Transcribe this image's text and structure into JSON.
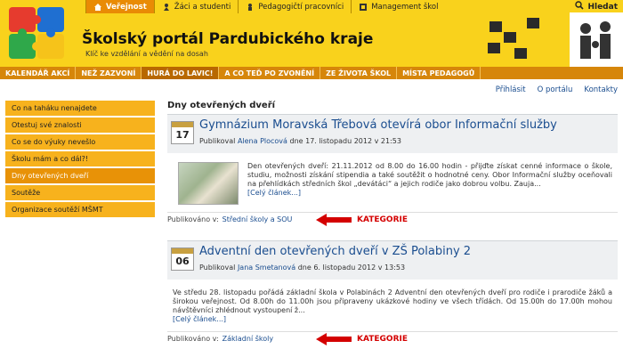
{
  "header": {
    "title": "Školský portál Pardubického kraje",
    "subtitle": "Klíč ke vzdělání a vědění na dosah",
    "search_label": "Hledat"
  },
  "top_tabs": [
    {
      "label": "Veřejnost",
      "icon": "home-icon"
    },
    {
      "label": "Žáci a studenti",
      "icon": "students-icon"
    },
    {
      "label": "Pedagogičtí pracovníci",
      "icon": "teacher-icon"
    },
    {
      "label": "Management škol",
      "icon": "management-icon"
    }
  ],
  "main_nav": [
    "KALENDÁŘ AKCÍ",
    "NEŽ ZAZVONÍ",
    "HURÁ DO LAVIC!",
    "A CO TEĎ PO ZVONĚNÍ",
    "ZE ŽIVOTA ŠKOL",
    "MÍSTA PEDAGOGŮ"
  ],
  "util_links": [
    "Přihlásit",
    "O portálu",
    "Kontakty"
  ],
  "sidebar": [
    "Co na taháku nenajdete",
    "Otestuj své znalosti",
    "Co se do výuky nevešlo",
    "Školu mám a co dál?!",
    "Dny otevřených dveří",
    "Soutěže",
    "Organizace soutěží MŠMT"
  ],
  "page_title": "Dny otevřených dveří",
  "articles": [
    {
      "day": "17",
      "title": "Gymnázium Moravská Třebová otevírá obor Informační služby",
      "published_by": "Publikoval",
      "author": "Alena Plocová",
      "date": "dne 17. listopadu 2012 v 21:53",
      "body": "Den otevřených dveří: 21.11.2012 od 8.00 do 16.00 hodin - přijďte získat cenné informace o škole, studiu, možnosti získání stipendia a také soutěžit o hodnotné ceny. Obor Informační služby oceňovali na přehlídkách středních škol „devátáci“ a jejich rodiče jako dobrou volbu. Zauja...",
      "more": "[Celý článek...]",
      "foot_label": "Publikováno v:",
      "category": "Střední školy a SOU"
    },
    {
      "day": "06",
      "title": "Adventní den otevřených dveří v ZŠ Polabiny 2",
      "published_by": "Publikoval",
      "author": "Jana Smetanová",
      "date": "dne 6. listopadu 2012 v 13:53",
      "body": "Ve středu 28. listopadu pořádá základní škola v Polabinách 2 Adventní den otevřených dveří pro rodiče i prarodiče žáků a širokou veřejnost. Od 8.00h do 11.00h jsou připraveny ukázkové hodiny ve všech třídách. Od 15.00h do 17.00h mohou návštěvníci zhlédnout vystoupení ž...",
      "more": "[Celý článek...]",
      "foot_label": "Publikováno v:",
      "category": "Základní školy"
    }
  ],
  "callout_label": "KATEGORIE",
  "colors": {
    "header": "#f9d21c",
    "nav": "#d6860a",
    "sidebar": "#f7b21d",
    "link": "#1a4d8f",
    "callout": "#d40000"
  }
}
